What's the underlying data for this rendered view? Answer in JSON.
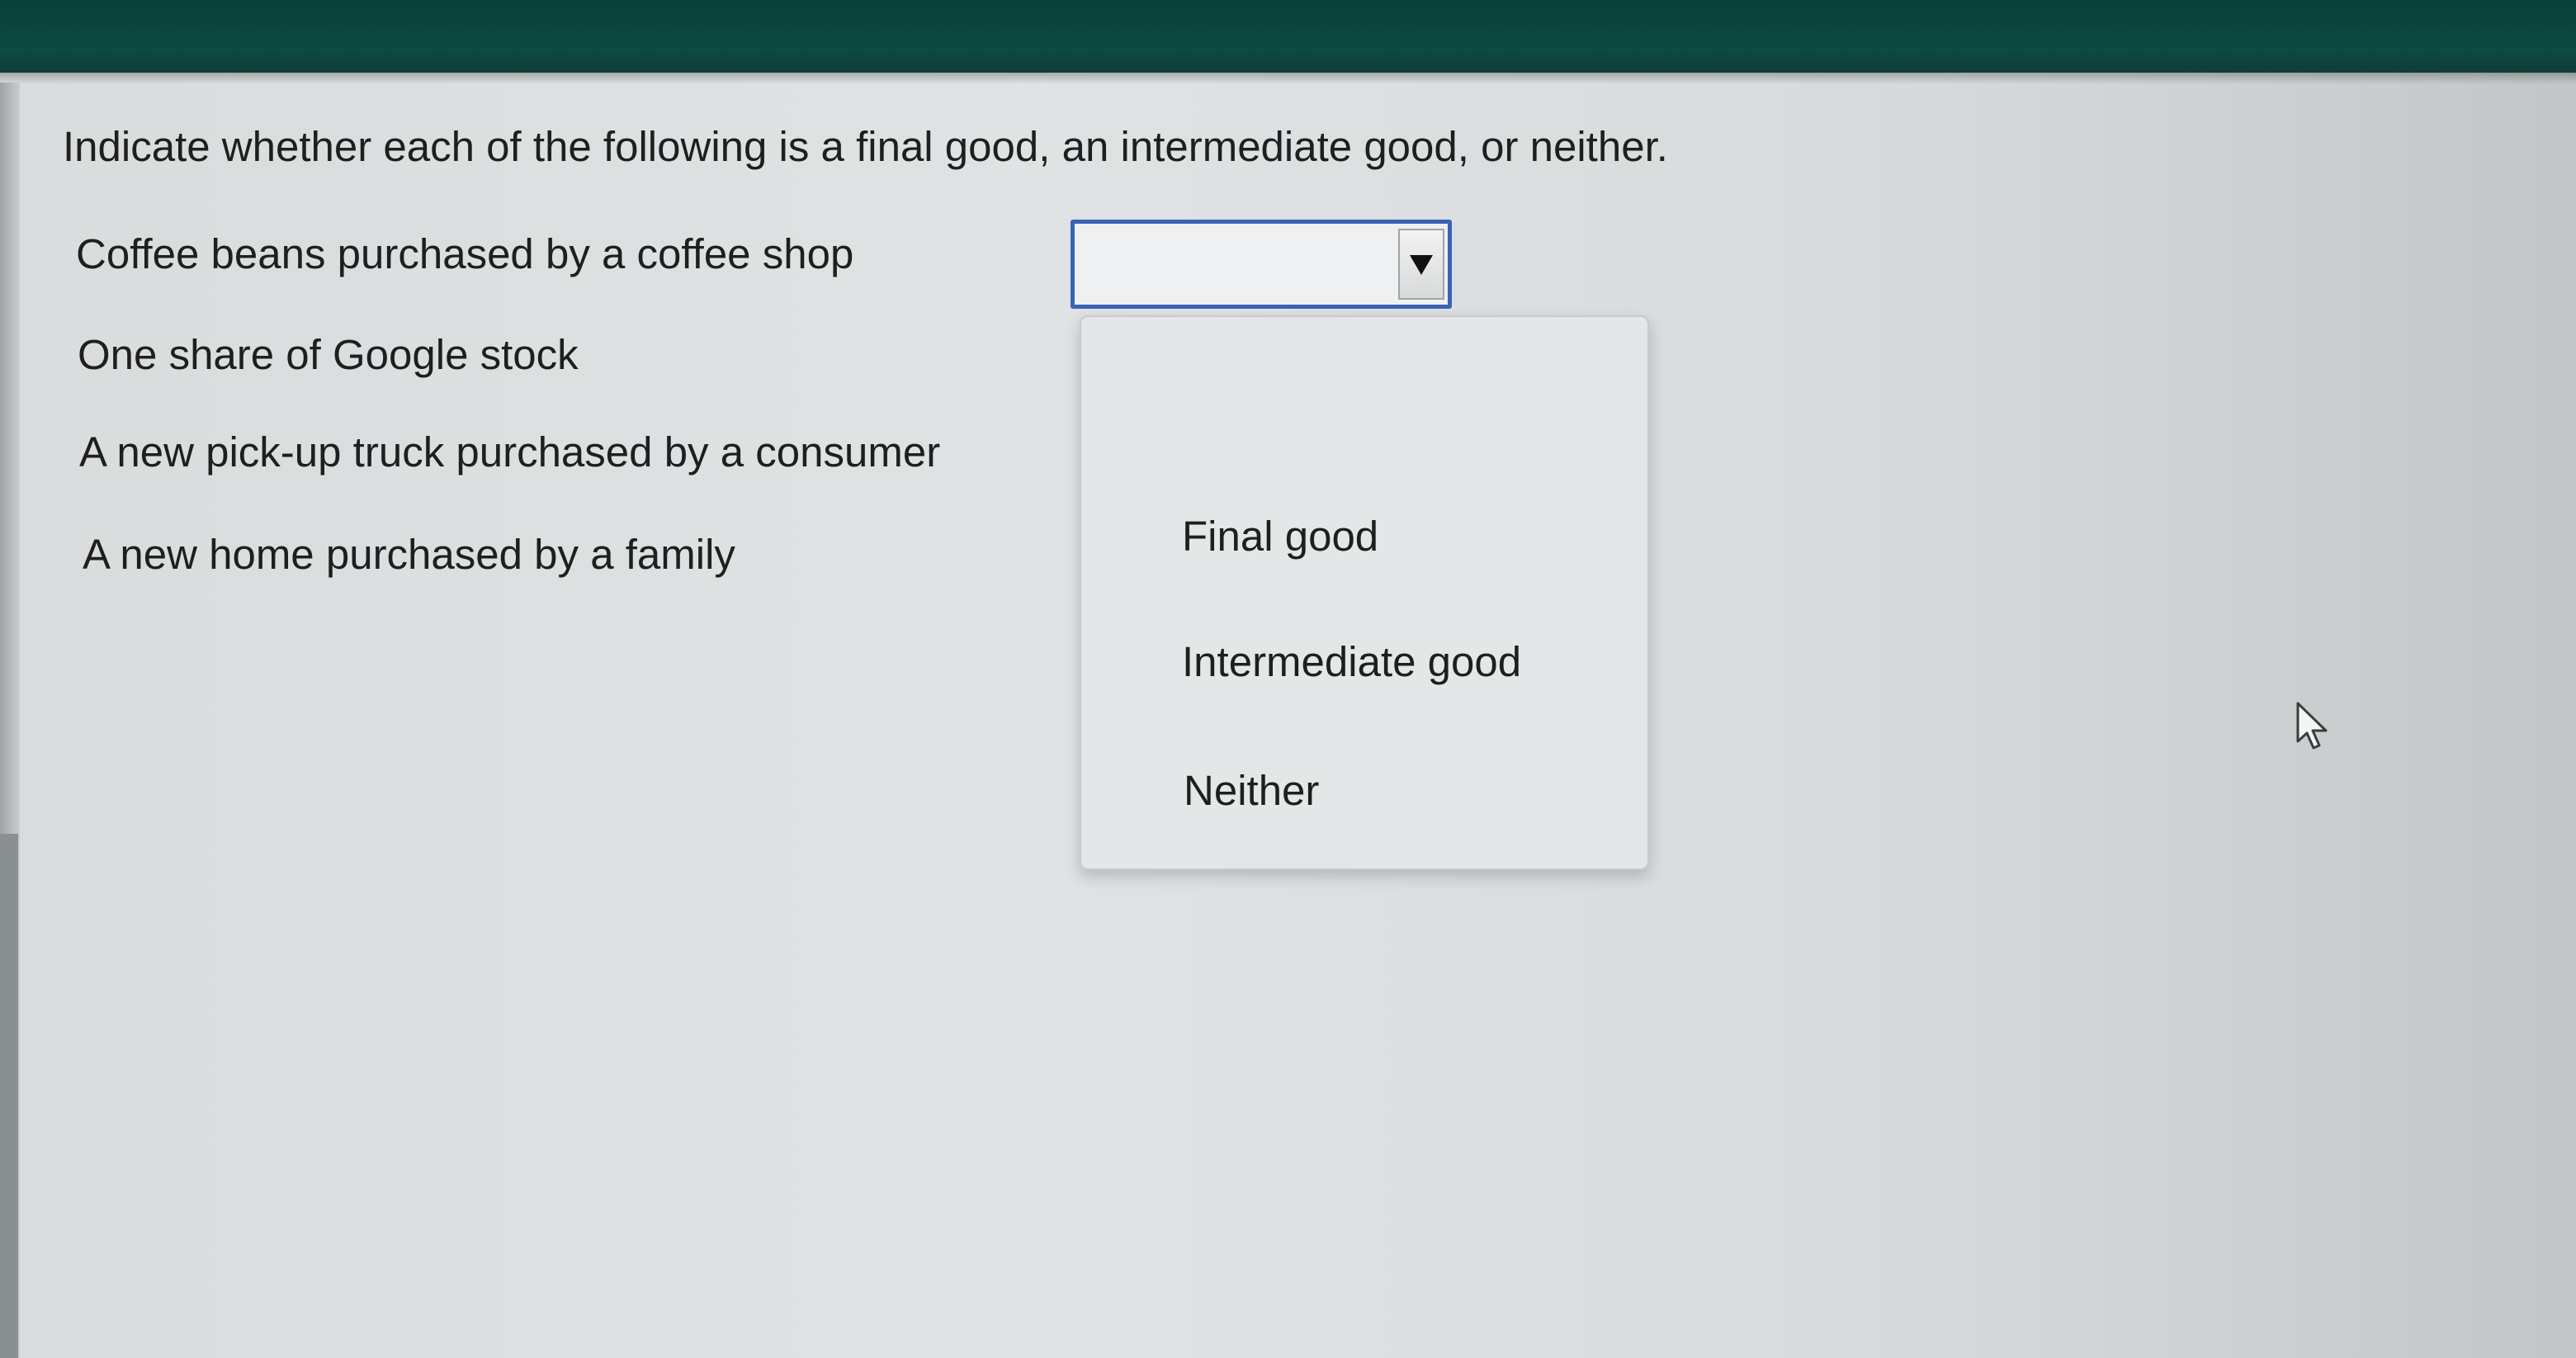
{
  "question": {
    "instructions": "Indicate whether each of the following is a final good, an intermediate good, or neither."
  },
  "items": [
    {
      "label": "Coffee beans purchased by a coffee shop"
    },
    {
      "label": "One share of Google stock"
    },
    {
      "label": "A new pick-up truck purchased by a consumer"
    },
    {
      "label": "A new home purchased by a family"
    }
  ],
  "select": {
    "value": "",
    "options": [
      "",
      "Final good",
      "Intermediate good",
      "Neither"
    ]
  },
  "colors": {
    "header": "#0c4a42",
    "select_border": "#3a63b5",
    "page_background": "#dfe3e4"
  },
  "icons": {
    "select_arrow": "triangle-down-icon",
    "cursor": "mouse-pointer-icon"
  }
}
